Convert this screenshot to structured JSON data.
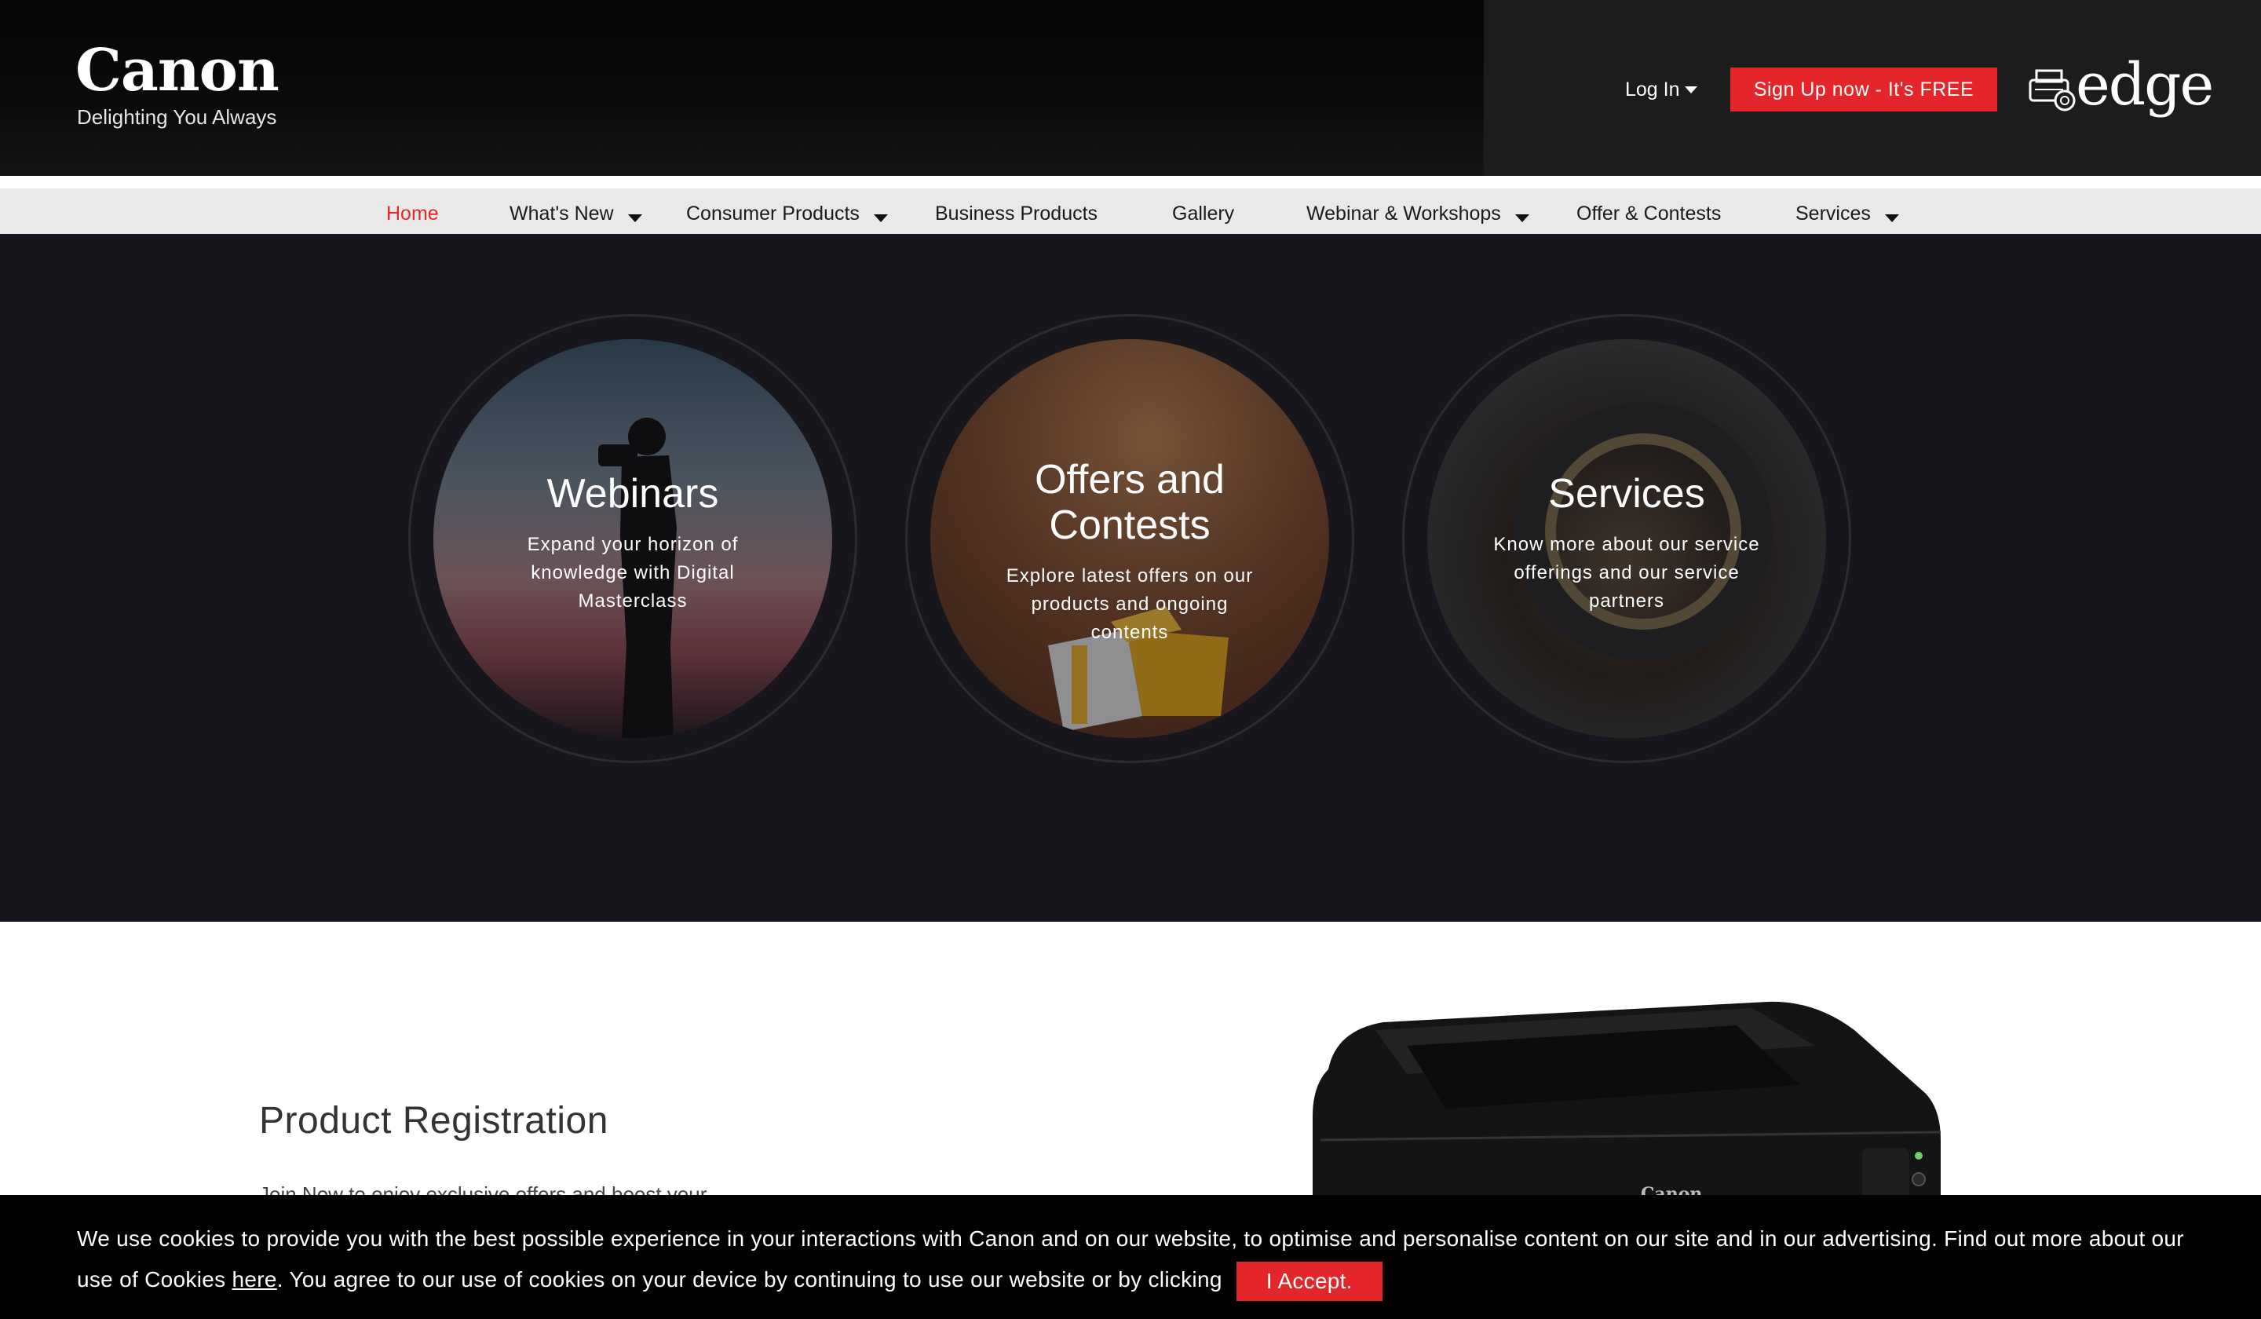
{
  "header": {
    "logo_word": "Canon",
    "logo_tagline": "Delighting You Always",
    "login_label": "Log In",
    "signup_label": "Sign Up now - It's FREE",
    "edge_logo_text": "edge"
  },
  "nav": {
    "items": [
      {
        "label": "Home",
        "active": true
      },
      {
        "label": "What's New",
        "dropdown": true
      },
      {
        "label": "Consumer Products",
        "dropdown": true
      },
      {
        "label": "Business Products"
      },
      {
        "label": "Gallery"
      },
      {
        "label": "Webinar & Workshops",
        "dropdown": true
      },
      {
        "label": "Offer & Contests"
      },
      {
        "label": "Services",
        "dropdown": true
      }
    ]
  },
  "hero": {
    "cards": [
      {
        "title": "Webinars",
        "description": "Expand your horizon of knowledge with Digital Masterclass"
      },
      {
        "title": "Offers and Contests",
        "description": "Explore latest offers on our products and ongoing contents"
      },
      {
        "title": "Services",
        "description": "Know more about our service offerings and our service partners"
      }
    ]
  },
  "registration": {
    "title": "Product Registration",
    "text": "Join Now to enjoy exclusive offers and boost your"
  },
  "printer_brand": "Canon",
  "cookie": {
    "text_before": "We use cookies to provide you with the best possible experience in your interactions with Canon and on our website, to optimise and personalise content on our site and in our advertising. Find out more about our use of Cookies ",
    "link_label": "here",
    "text_after": ". You agree to our use of cookies on your device by continuing to use our website or by clicking",
    "accept_label": "I Accept."
  },
  "colors": {
    "accent": "#e4262a",
    "header_bg": "#1c1c1c",
    "nav_bg": "#e9e9e9",
    "hero_bg": "#16161c",
    "cookie_bg": "#000000"
  }
}
